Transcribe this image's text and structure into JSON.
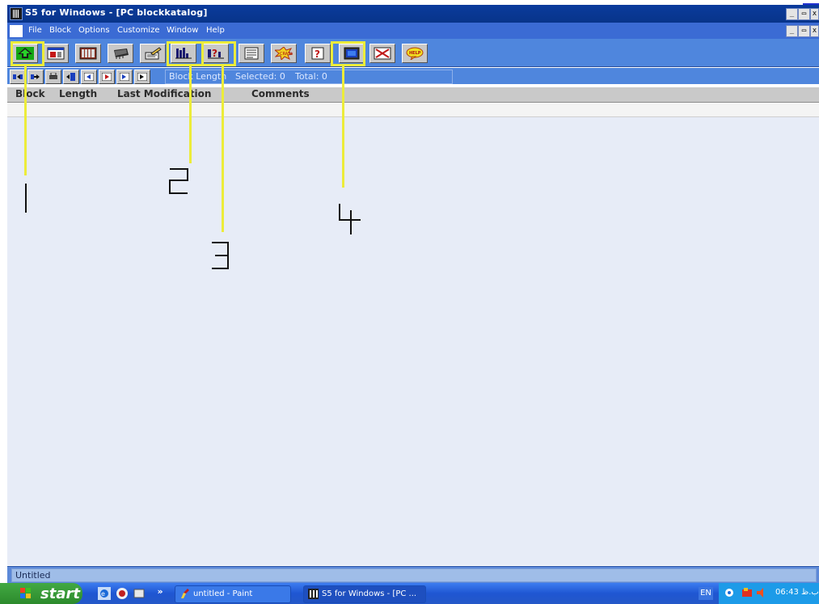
{
  "window": {
    "title": "S5 for Windows - [PC blockkatalog]",
    "controls": [
      "minimize",
      "restore",
      "close"
    ]
  },
  "menu": {
    "items": [
      {
        "label": "File"
      },
      {
        "label": "Block"
      },
      {
        "label": "Options"
      },
      {
        "label": "Customize"
      },
      {
        "label": "Window"
      },
      {
        "label": "Help"
      }
    ]
  },
  "toolbar": {
    "buttons": [
      {
        "icon": "green-arrow-up-icon"
      },
      {
        "icon": "block-window-icon"
      },
      {
        "icon": "plc-rack-icon"
      },
      {
        "icon": "program-module-icon"
      },
      {
        "icon": "edit-pencil-icon"
      },
      {
        "icon": "ladder-blocks-icon"
      },
      {
        "icon": "block-query-icon"
      },
      {
        "icon": "document-list-icon"
      },
      {
        "icon": "crash-icon"
      },
      {
        "icon": "question-mark-icon"
      },
      {
        "icon": "monitor-display-icon"
      },
      {
        "icon": "cancel-x-icon"
      },
      {
        "icon": "help-balloon-icon"
      }
    ]
  },
  "toolbar2": {
    "info": {
      "label": "Block Length",
      "selected": "Selected: 0",
      "total": "Total: 0"
    }
  },
  "columns": [
    {
      "label": "Block"
    },
    {
      "label": "Length"
    },
    {
      "label": "Last Modification"
    },
    {
      "label": "Comments"
    }
  ],
  "status": {
    "text": "Untitled"
  },
  "taskbar": {
    "start_label": "start",
    "tasks": [
      {
        "label": "untitled - Paint"
      },
      {
        "label": "S5 for Windows - [PC ..."
      }
    ],
    "language": "EN",
    "clock": "06:43 ب.ظ"
  },
  "annotations": {
    "markers": [
      "1",
      "2",
      "3",
      "4"
    ],
    "color": "#ecec3a"
  },
  "colors": {
    "title_bar": "#0a3b9c",
    "menu_bar": "#3b6bd4",
    "toolbar": "#4f86dd",
    "column_header": "#c9c9c9",
    "main_area": "#e7ecf7",
    "taskbar": "#2458c8",
    "start_button": "#2c8a2c"
  }
}
